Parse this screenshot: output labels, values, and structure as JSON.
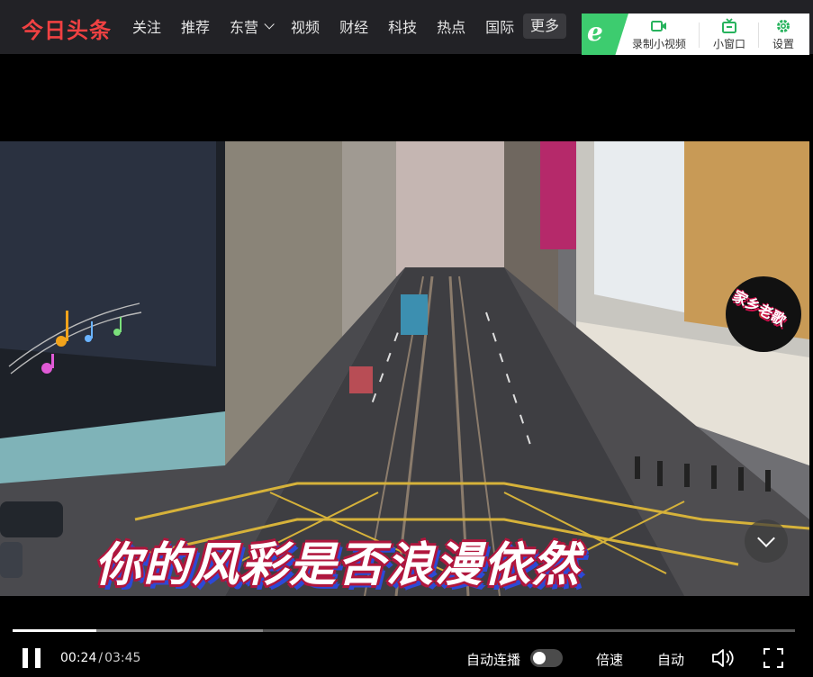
{
  "header": {
    "logo": "今日头条",
    "nav": [
      {
        "label": "关注"
      },
      {
        "label": "推荐"
      },
      {
        "label": "东营"
      },
      {
        "label": "视频"
      },
      {
        "label": "财经"
      },
      {
        "label": "科技"
      },
      {
        "label": "热点"
      },
      {
        "label": "国际"
      }
    ],
    "more_label": "更多"
  },
  "extension": {
    "badge": "e",
    "record_label": "录制小视频",
    "mini_window_label": "小窗口",
    "settings_label": "设置",
    "accent_color": "#3dcc6f"
  },
  "video": {
    "subtitle": "你的风彩是否浪漫依然",
    "watermark": "家乡老歌"
  },
  "player": {
    "current_time": "00:24",
    "separator": "/",
    "duration": "03:45",
    "played_fraction": 0.107,
    "buffered_fraction": 0.32,
    "autoplay_label": "自动连播",
    "autoplay_on": false,
    "speed_label": "倍速",
    "quality_label": "自动"
  }
}
